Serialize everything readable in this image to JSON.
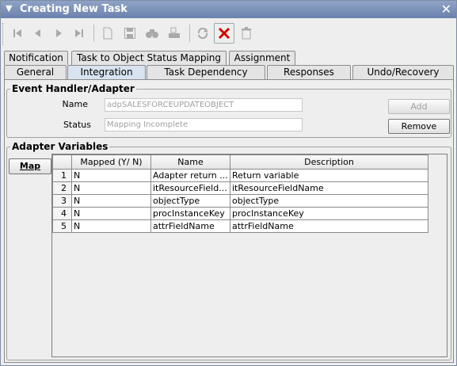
{
  "window": {
    "title": "Creating New Task"
  },
  "toolbar": {
    "buttons": [
      "first-icon",
      "previous-icon",
      "next-icon",
      "last-icon",
      "new-icon",
      "save-icon",
      "find-icon",
      "print-icon",
      "refresh-icon",
      "delete-icon",
      "trash-icon"
    ]
  },
  "tabs": {
    "row1": [
      "Notification",
      "Task to Object Status Mapping",
      "Assignment"
    ],
    "row2": [
      "General",
      "Integration",
      "Task Dependency",
      "Responses",
      "Undo/Recovery"
    ],
    "selected": "Integration"
  },
  "event_handler": {
    "legend": "Event Handler/Adapter",
    "name_label": "Name",
    "name_value": "adpSALESFORCEUPDATEOBJECT",
    "status_label": "Status",
    "status_value": "Mapping Incomplete",
    "add_label": "Add",
    "remove_label": "Remove"
  },
  "adapter_variables": {
    "legend": "Adapter Variables",
    "map_label": "Map",
    "columns": [
      "Mapped (Y/ N)",
      "Name",
      "Description"
    ],
    "rows": [
      {
        "num": "1",
        "mapped": "N",
        "name": "Adapter return ...",
        "description": "Return variable"
      },
      {
        "num": "2",
        "mapped": "N",
        "name": "itResourceField...",
        "description": "itResourceFieldName"
      },
      {
        "num": "3",
        "mapped": "N",
        "name": "objectType",
        "description": "objectType"
      },
      {
        "num": "4",
        "mapped": "N",
        "name": "procInstanceKey",
        "description": "procInstanceKey"
      },
      {
        "num": "5",
        "mapped": "N",
        "name": "attrFieldName",
        "description": "attrFieldName"
      }
    ]
  }
}
